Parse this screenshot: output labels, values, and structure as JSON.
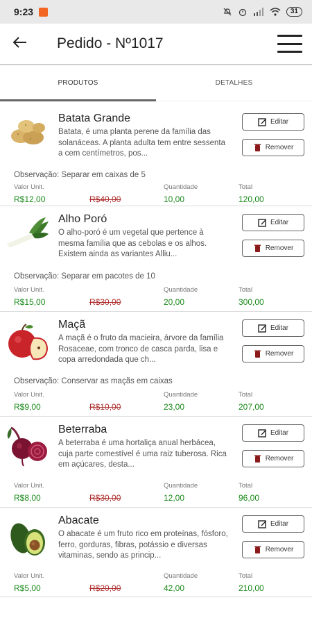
{
  "statusbar": {
    "time": "9:23",
    "battery": "31"
  },
  "header": {
    "title": "Pedido - Nº1017"
  },
  "tabs": [
    {
      "label": "PRODUTOS"
    },
    {
      "label": "DETALHES"
    }
  ],
  "labels": {
    "unit": "Valor Unit.",
    "quantity": "Quantidade",
    "total": "Total",
    "edit": "Editar",
    "remove": "Remover"
  },
  "colors": {
    "price": "#1a8a1a",
    "old_price": "#b03030",
    "remove_icon": "#8b1a1a"
  },
  "products": [
    {
      "name": "Batata Grande",
      "description": "Batata, é uma planta perene da família das solanáceas. A planta adulta tem entre sessenta a cem centímetros, pos...",
      "observation": "Observação: Separar em caixas de 5",
      "unit_price": "R$12,00",
      "old_price": "R$40,00",
      "quantity": "10,00",
      "total": "120,00"
    },
    {
      "name": "Alho Poró",
      "description": "O alho-poró é um vegetal que pertence à mesma família que as cebolas e os alhos. Existem ainda as variantes Alliu...",
      "observation": "Observação: Separar em pacotes de 10",
      "unit_price": "R$15,00",
      "old_price": "R$30,00",
      "quantity": "20,00",
      "total": "300,00"
    },
    {
      "name": "Maçã",
      "description": "A maçã é o fruto da macieira, árvore da família Rosaceae, com tronco de casca parda, lisa e copa arredondada que ch...",
      "observation": "Observação: Conservar as maçãs em caixas",
      "unit_price": "R$9,00",
      "old_price": "R$10,00",
      "quantity": "23,00",
      "total": "207,00"
    },
    {
      "name": "Beterraba",
      "description": "A beterraba é uma hortaliça anual herbácea, cuja parte comestível é uma raiz tuberosa. Rica em açúcares, desta...",
      "observation": "",
      "unit_price": "R$8,00",
      "old_price": "R$30,00",
      "quantity": "12,00",
      "total": "96,00"
    },
    {
      "name": "Abacate",
      "description": "O abacate é um fruto rico em proteínas, fósforo, ferro, gorduras, fibras, potássio e diversas vitaminas, sendo as princip...",
      "observation": "",
      "unit_price": "R$5,00",
      "old_price": "R$20,00",
      "quantity": "42,00",
      "total": "210,00"
    }
  ]
}
